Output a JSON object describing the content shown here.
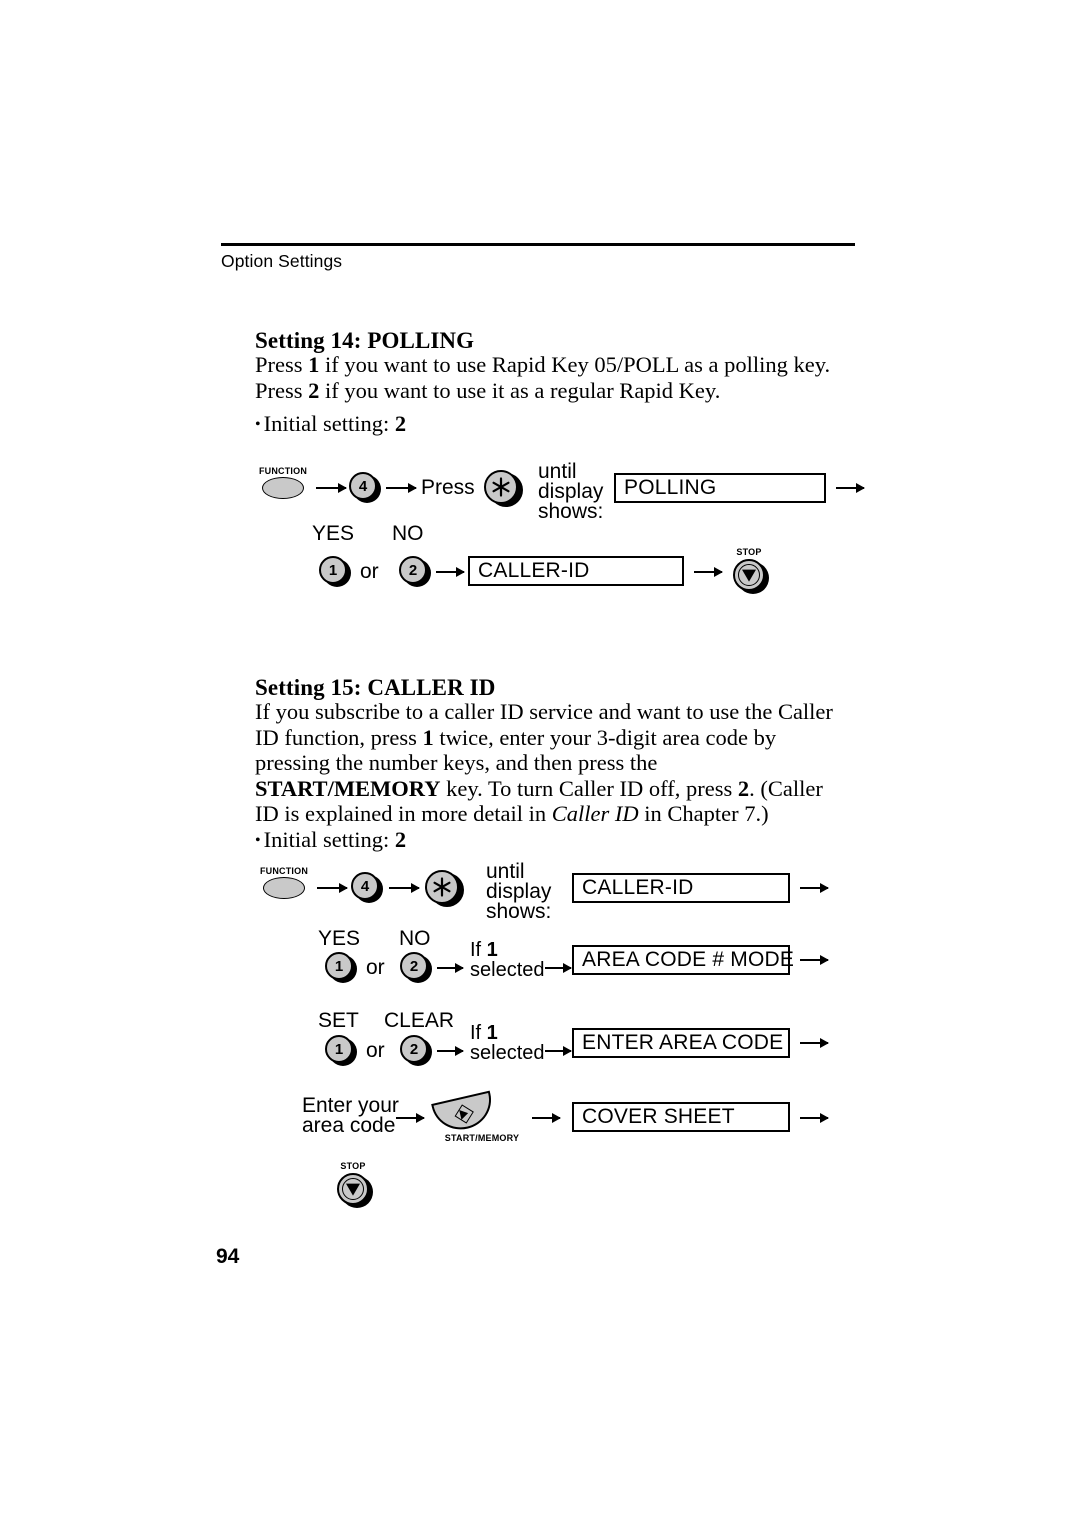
{
  "header": {
    "running_head": "Option Settings"
  },
  "page_number": "94",
  "sections": [
    {
      "id": "setting14",
      "heading": "Setting 14: POLLING",
      "paragraph_html": "Press <b>1</b> if you want to use Rapid Key 05/POLL as a polling key. Press <b>2</b> if you want to use it as a regular Rapid Key.",
      "initial_setting_label": "Initial setting:",
      "initial_setting_value": "2"
    },
    {
      "id": "setting15",
      "heading": "Setting 15: CALLER ID",
      "paragraph_html": "If you subscribe to a caller ID service and want to use the Caller ID function, press <b>1</b> twice, enter your 3-digit area code by pressing the number keys, and then press the <b>START/MEMORY</b> key. To turn Caller ID off, press <b>2</b>. (Caller ID is explained in more detail in <i>Caller ID</i> in Chapter 7.)",
      "initial_setting_label": "Initial setting:",
      "initial_setting_value": "2"
    }
  ],
  "diagram1": {
    "function_caption": "FUNCTION",
    "key_4": "4",
    "press_label": "Press",
    "asterisk_key": "✳",
    "until_display_shows": "until\ndisplay\nshows:",
    "until_line1": "until",
    "until_line2": "display",
    "until_line3": "shows:",
    "display_polling": "POLLING",
    "yes_label": "YES",
    "no_label": "NO",
    "key_1": "1",
    "or_label": "or",
    "key_2": "2",
    "display_caller_id": "CALLER-ID",
    "stop_caption": "STOP"
  },
  "diagram2": {
    "function_caption": "FUNCTION",
    "key_4": "4",
    "asterisk_key": "✳",
    "until_line1": "until",
    "until_line2": "display",
    "until_line3": "shows:",
    "display_caller_id": "CALLER-ID",
    "yes_label": "YES",
    "no_label": "NO",
    "key_1a": "1",
    "or_label_a": "or",
    "key_2a": "2",
    "if1_line1_prefix": "If ",
    "if1_line1_bold": "1",
    "if1_line2": "selected",
    "display_area_code_mode": "AREA CODE # MODE",
    "set_label": "SET",
    "clear_label": "CLEAR",
    "key_1b": "1",
    "or_label_b": "or",
    "key_2b": "2",
    "if2_line1_prefix": "If ",
    "if2_line1_bold": "1",
    "if2_line2": "selected",
    "display_enter_area_code": "ENTER AREA CODE",
    "enter_line1": "Enter your",
    "enter_line2": "area code",
    "start_caption": "START/MEMORY",
    "display_cover_sheet": "COVER SHEET",
    "stop_caption": "STOP"
  }
}
